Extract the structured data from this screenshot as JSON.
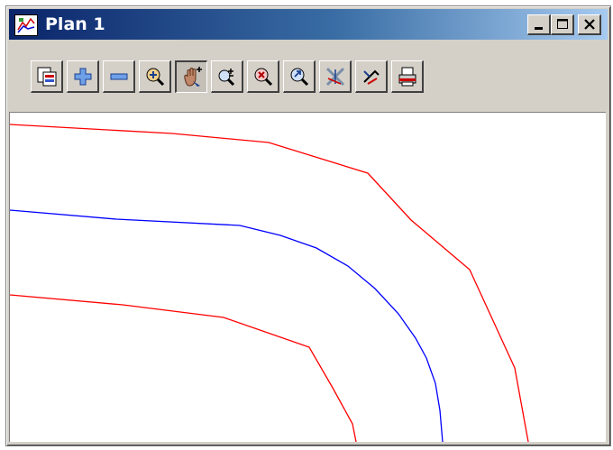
{
  "window": {
    "title": "Plan 1",
    "icon": "plan-view-icon",
    "controls": [
      "minimize-icon",
      "maximize-icon",
      "close-icon"
    ]
  },
  "toolbar": {
    "buttons": [
      {
        "icon": "plot-frame-icon"
      },
      {
        "icon": "zoom-in-icon"
      },
      {
        "icon": "zoom-out-icon"
      },
      {
        "icon": "zoom-fit-icon"
      },
      {
        "icon": "pan-hand-icon",
        "pressed": true
      },
      {
        "icon": "zoom-window-icon"
      },
      {
        "icon": "zoom-center-icon"
      },
      {
        "icon": "zoom-previous-icon"
      },
      {
        "icon": "cursor-crosshair-icon"
      },
      {
        "icon": "pick-icon"
      },
      {
        "icon": "print-icon"
      }
    ]
  },
  "colors": {
    "boundary_line": "#ff0000",
    "centre_line": "#0000ff",
    "titlebar_start": "#0a246a",
    "titlebar_end": "#a6caf0",
    "toolbar_face": "#d4d0c8"
  }
}
